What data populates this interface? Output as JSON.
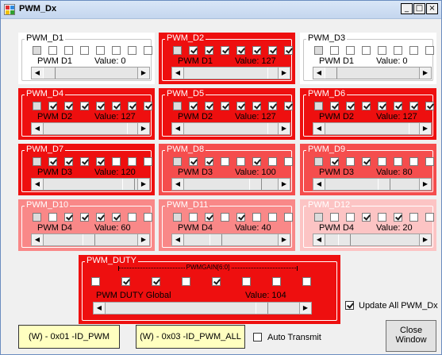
{
  "window": {
    "title": "PWM_Dx",
    "minimize": "_",
    "maximize": "□",
    "close": "×"
  },
  "colors": {
    "level1": "#ee0f0f",
    "level2": "#f54d4d",
    "level3": "#f98888",
    "level4": "#fcc4c4",
    "off": "#ffffff"
  },
  "scroll": {
    "left_arrow": "◀",
    "right_arrow": "▶"
  },
  "groups": [
    {
      "name": "PWM_D1",
      "label": "PWM D1",
      "value_text": "Value: 0",
      "value": 0,
      "bits": [
        false,
        false,
        false,
        false,
        false,
        false,
        false,
        false
      ],
      "level": "off"
    },
    {
      "name": "PWM_D2",
      "label": "PWM D1",
      "value_text": "Value: 127",
      "value": 127,
      "bits": [
        false,
        true,
        true,
        true,
        true,
        true,
        true,
        true
      ],
      "level": "level1"
    },
    {
      "name": "PWM_D3",
      "label": "PWM D1",
      "value_text": "Value: 0",
      "value": 0,
      "bits": [
        false,
        false,
        false,
        false,
        false,
        false,
        false,
        false
      ],
      "level": "off"
    },
    {
      "name": "PWM_D4",
      "label": "PWM D2",
      "value_text": "Value: 127",
      "value": 127,
      "bits": [
        false,
        true,
        true,
        true,
        true,
        true,
        true,
        true
      ],
      "level": "level1"
    },
    {
      "name": "PWM_D5",
      "label": "PWM D2",
      "value_text": "Value: 127",
      "value": 127,
      "bits": [
        false,
        true,
        true,
        true,
        true,
        true,
        true,
        true
      ],
      "level": "level1"
    },
    {
      "name": "PWM_D6",
      "label": "PWM D2",
      "value_text": "Value: 127",
      "value": 127,
      "bits": [
        false,
        true,
        true,
        true,
        true,
        true,
        true,
        true
      ],
      "level": "level1"
    },
    {
      "name": "PWM_D7",
      "label": "PWM D3",
      "value_text": "Value: 120",
      "value": 120,
      "bits": [
        false,
        true,
        true,
        true,
        true,
        false,
        false,
        false
      ],
      "level": "level1"
    },
    {
      "name": "PWM_D8",
      "label": "PWM D3",
      "value_text": "Value: 100",
      "value": 100,
      "bits": [
        false,
        true,
        true,
        false,
        false,
        true,
        false,
        false
      ],
      "level": "level2"
    },
    {
      "name": "PWM_D9",
      "label": "PWM D3",
      "value_text": "Value: 80",
      "value": 80,
      "bits": [
        false,
        true,
        false,
        true,
        false,
        false,
        false,
        false
      ],
      "level": "level2"
    },
    {
      "name": "PWM_D10",
      "label": "PWM D4",
      "value_text": "Value: 60",
      "value": 60,
      "bits": [
        false,
        false,
        true,
        true,
        true,
        true,
        false,
        false
      ],
      "level": "level3"
    },
    {
      "name": "PWM_D11",
      "label": "PWM D4",
      "value_text": "Value: 40",
      "value": 40,
      "bits": [
        false,
        false,
        true,
        false,
        true,
        false,
        false,
        false
      ],
      "level": "level3"
    },
    {
      "name": "PWM_D12",
      "label": "PWM D4",
      "value_text": "Value: 20",
      "value": 20,
      "bits": [
        false,
        false,
        false,
        true,
        false,
        true,
        false,
        false
      ],
      "level": "level4"
    }
  ],
  "duty": {
    "name": "PWM_DUTY",
    "gain_label": "PWMGAIN[6:0]",
    "label": "PWM DUTY Global",
    "value_text": "Value: 104",
    "value": 104,
    "bits": [
      false,
      true,
      true,
      false,
      true,
      false,
      false,
      false
    ]
  },
  "update_all": {
    "label": "Update All PWM_Dx",
    "checked": true
  },
  "buttons": {
    "write_pwm": "(W) - 0x01 -ID_PWM",
    "write_pwm_all": "(W) - 0x03 -ID_PWM_ALL",
    "close_line1": "Close",
    "close_line2": "Window"
  },
  "auto_transmit": {
    "label": "Auto Transmit",
    "checked": false
  }
}
